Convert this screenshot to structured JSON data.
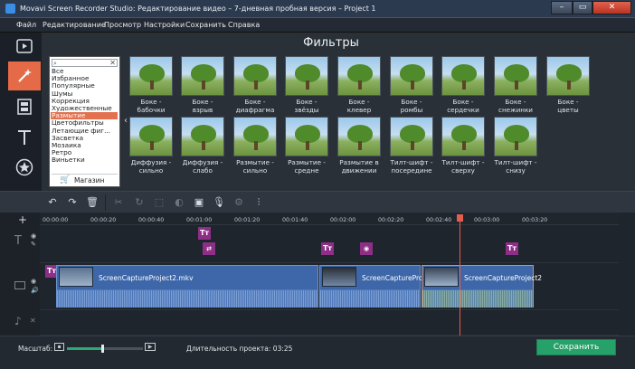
{
  "window": {
    "title": "Movavi Screen Recorder Studio: Редактирование видео – 7-дневная пробная версия – Project 1",
    "min": "–",
    "max": "▭",
    "close": "✕"
  },
  "menu": [
    "Файл",
    "Редактирование",
    "Просмотр",
    "Настройки",
    "Сохранить",
    "Справка"
  ],
  "panel": {
    "title": "Фильтры",
    "search_clear": "✕",
    "categories": [
      "Все",
      "Избранное",
      "Популярные",
      "Шумы",
      "Коррекция",
      "Художественные",
      "Размытие",
      "Цветофильтры",
      "Летающие фиг...",
      "Засветка",
      "Мозаика",
      "Ретро",
      "Виньетки"
    ],
    "selected_category": "Размытие",
    "shop_label": "Магазин",
    "collapse_glyph": "‹",
    "filters_row1": [
      "Боке -\nбабочки",
      "Боке -\nвзрыв",
      "Боке -\nдиафрагма",
      "Боке -\nзвёзды",
      "Боке -\nклевер",
      "Боке -\nромбы",
      "Боке -\nсердечки",
      "Боке -\nснежинки",
      "Боке -\nцветы"
    ],
    "filters_row2": [
      "Диффузия -\nсильно",
      "Диффузия -\nслабо",
      "Размытие -\nсильно",
      "Размытие -\nсредне",
      "Размытие в\nдвижении",
      "Тилт-шифт -\nпосередине",
      "Тилт-шифт -\nсверху",
      "Тилт-шифт -\nснизу"
    ]
  },
  "toolbar": {
    "undo": "↶",
    "redo": "↷",
    "delete": "🗑",
    "cut": "✂",
    "rotate": "↻",
    "crop": "⬚",
    "color": "◐",
    "image": "▣",
    "mic": "🎙",
    "settings": "⚙",
    "eq": "⫶"
  },
  "timeline": {
    "ticks": [
      "00:00:00",
      "00:00:20",
      "00:00:40",
      "00:01:00",
      "00:01:20",
      "00:01:40",
      "00:02:00",
      "00:02:20",
      "00:02:40",
      "00:03:00",
      "00:03:20"
    ],
    "clips": [
      "ScreenCaptureProject2.mkv",
      "ScreenCaptureProj",
      "ScreenCaptureProject2"
    ],
    "title_badge": "Tт"
  },
  "status": {
    "scale_label": "Масштаб:",
    "zoom_level": 0.47,
    "duration_label": "Длительность проекта:",
    "duration_value": "03:25",
    "save_label": "Сохранить"
  },
  "colors": {
    "accent": "#e56b48",
    "save": "#26a16a",
    "clip": "#4e77b8",
    "playhead": "#e35d4f",
    "title_badge": "#8e2f87"
  }
}
